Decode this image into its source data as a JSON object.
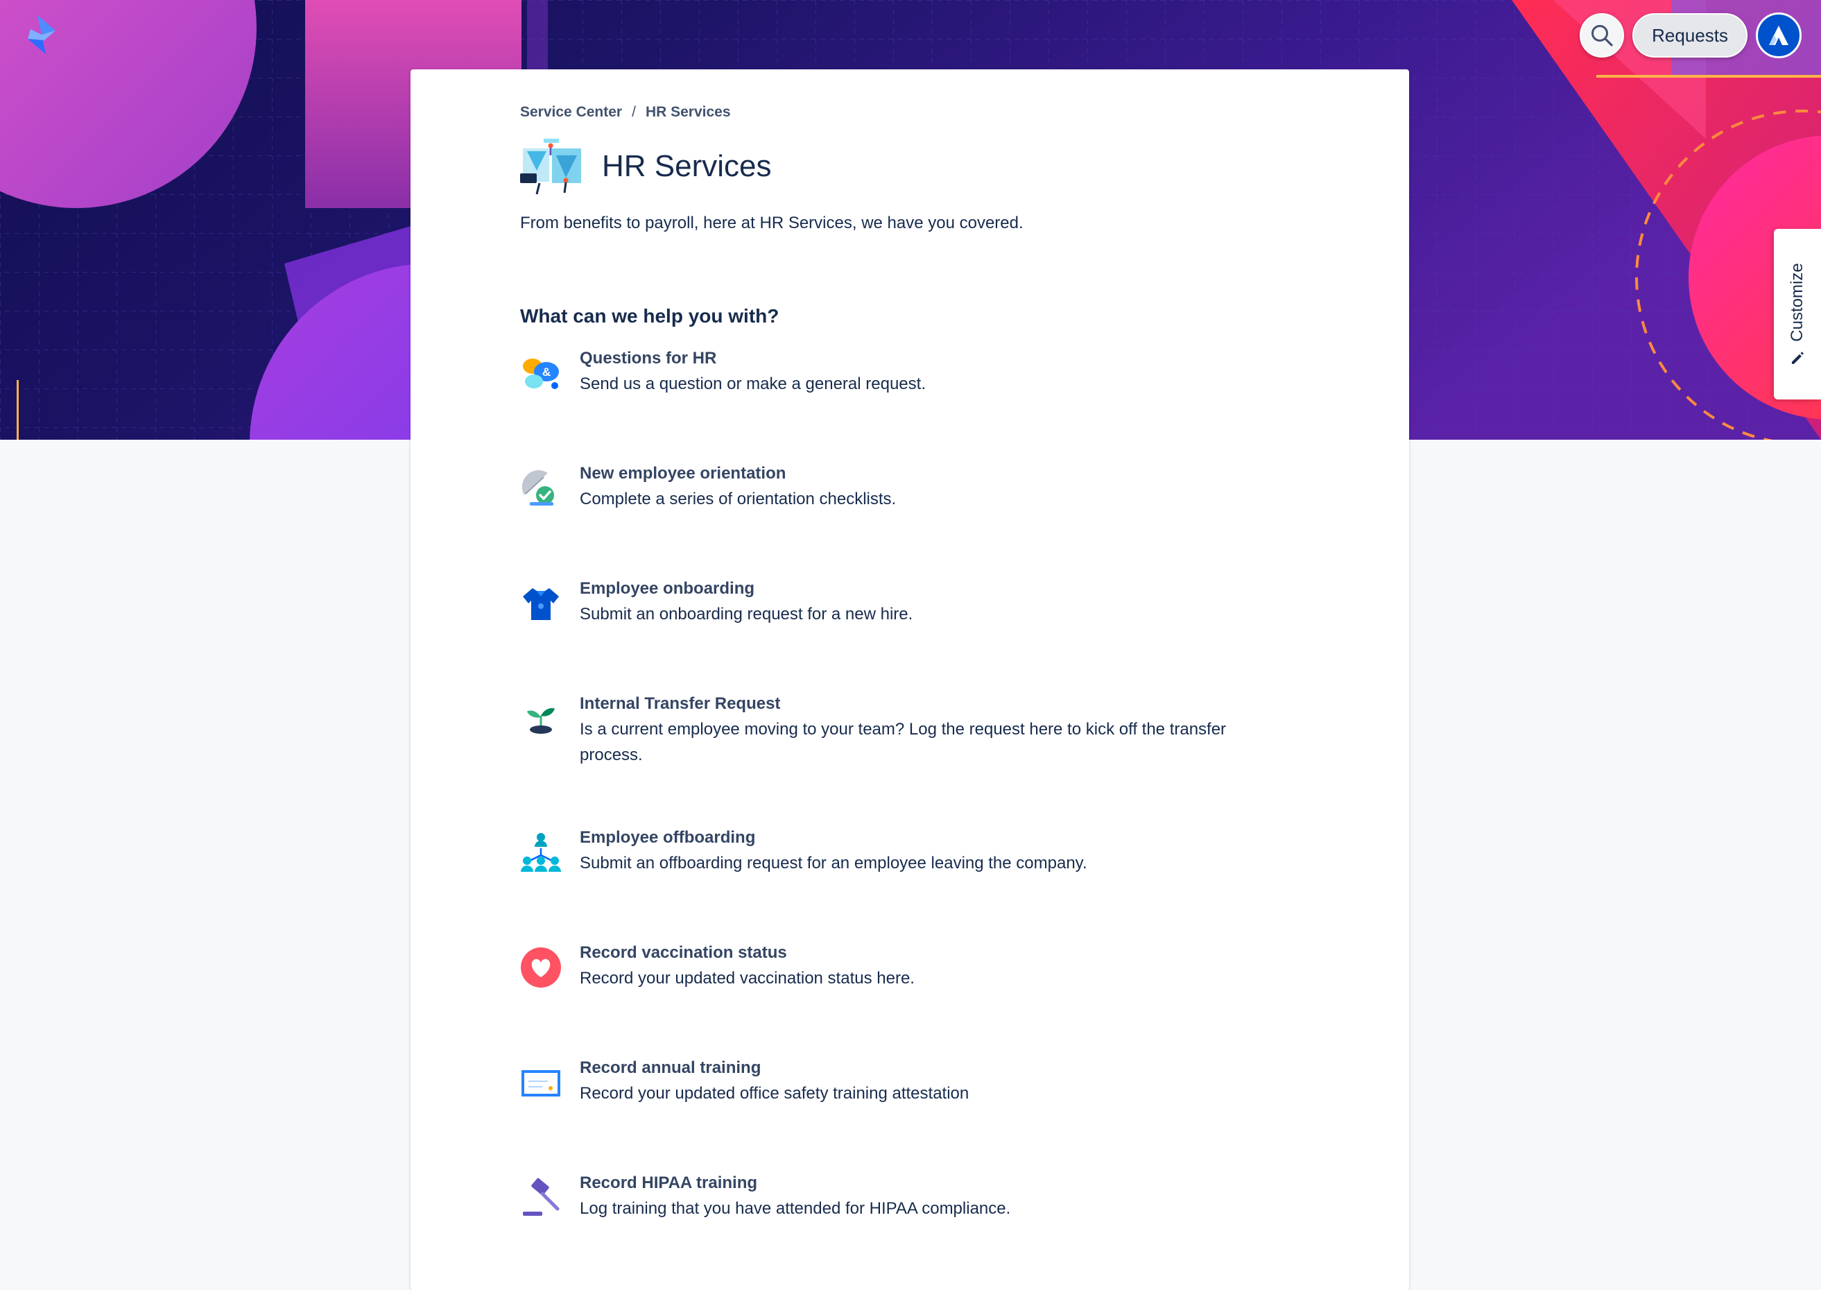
{
  "header": {
    "logo_icon": "jira-service-lightning-icon",
    "search_icon": "search-icon",
    "requests_label": "Requests",
    "avatar_icon": "atlassian-logo-icon",
    "customize_label": "Customize",
    "customize_icon": "pencil-icon"
  },
  "breadcrumb": {
    "items": [
      "Service Center",
      "HR Services"
    ],
    "separator": "/"
  },
  "portal": {
    "title": "HR Services",
    "description": "From benefits to payroll, here at HR Services, we have you covered.",
    "section_title": "What can we help you with?"
  },
  "request_types": [
    {
      "name": "Questions for HR",
      "description": "Send us a question or make a general request.",
      "icon": "speech-bubbles-icon"
    },
    {
      "name": "New employee orientation",
      "description": "Complete a series of orientation checklists.",
      "icon": "satellite-check-icon"
    },
    {
      "name": "Employee onboarding",
      "description": "Submit an onboarding request for a new hire.",
      "icon": "shirt-icon"
    },
    {
      "name": "Internal Transfer Request",
      "description": "Is a current employee moving to your team? Log the request here to kick off the transfer process.",
      "icon": "sprout-icon"
    },
    {
      "name": "Employee offboarding",
      "description": "Submit an offboarding request for an employee leaving the company.",
      "icon": "org-people-icon"
    },
    {
      "name": "Record vaccination status",
      "description": "Record your updated vaccination status here.",
      "icon": "heart-icon"
    },
    {
      "name": "Record annual training",
      "description": "Record your updated office safety training attestation",
      "icon": "certificate-icon"
    },
    {
      "name": "Record HIPAA training",
      "description": "Log training that you have attended for HIPAA compliance.",
      "icon": "gavel-icon"
    }
  ],
  "colors": {
    "brand_blue": "#0052cc",
    "banner_purple": "#3a1b8f",
    "text_dark": "#172b4d"
  }
}
